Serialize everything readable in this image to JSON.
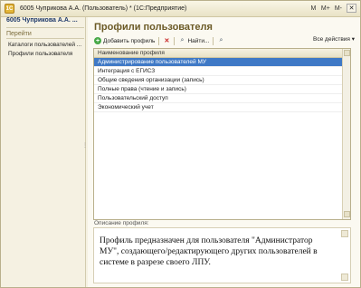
{
  "window": {
    "title": "6005 Чуприкова А.А. (Пользователь) * (1С:Предприятие)",
    "tools": [
      "M",
      "M+",
      "M-"
    ],
    "close_symbol": "✕"
  },
  "sidebar": {
    "title": "6005 Чуприкова А.А. ...",
    "section": "Перейти",
    "links": [
      "Каталоги пользователей ...",
      "Профили пользователя"
    ]
  },
  "main": {
    "title": "Профили пользователя",
    "toolbar": {
      "add_label": "Добавить профиль",
      "find_label": "Найти...",
      "actions_label": "Все действия ▾"
    },
    "grid": {
      "header": "Наименование профиля",
      "rows": [
        "Администрирование пользователей МУ",
        "Интеграция с ЕГИСЗ",
        "Общие сведения организации (запись)",
        "Полные права (чтение и запись)",
        "Пользовательский доступ",
        "Экономический учет"
      ],
      "selected_index": 0
    },
    "description": {
      "label": "Описание профиля:",
      "text": "Профиль предназначен для пользователя \"Администратор МУ\", создающего/редактирующего других пользователей в системе в разрезе своего ЛПУ."
    }
  },
  "colors": {
    "accent_title": "#6b5a26",
    "selection": "#3f79c6",
    "background": "#f5f1e2"
  }
}
